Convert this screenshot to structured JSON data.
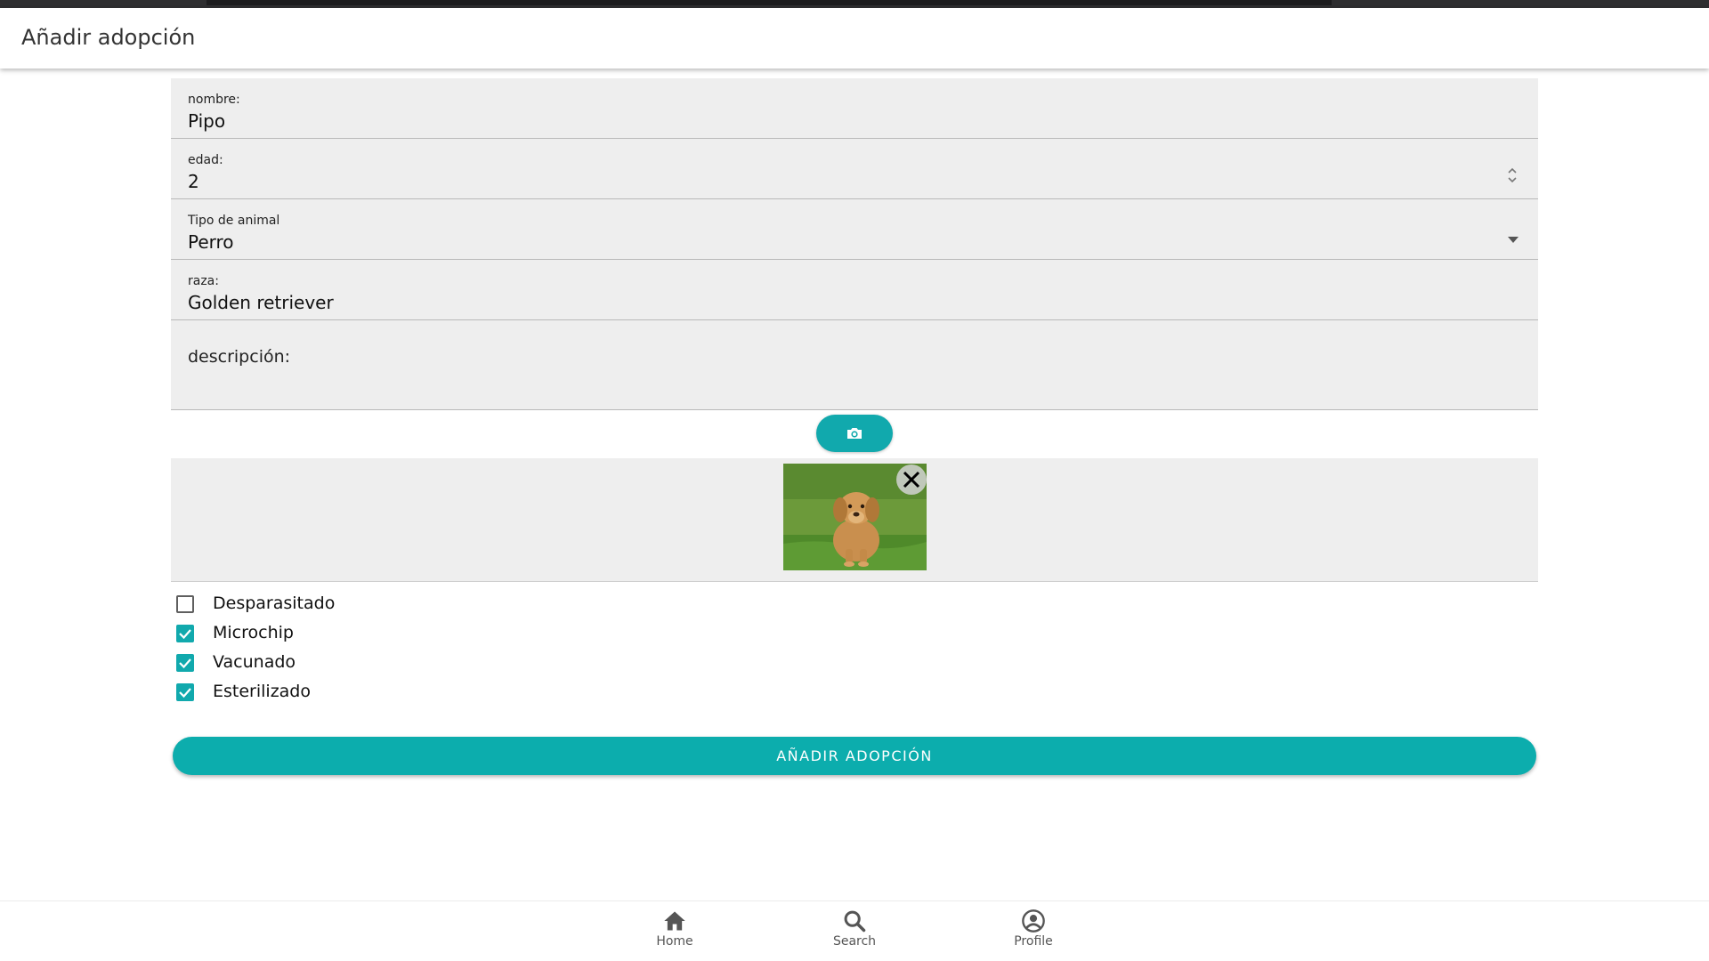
{
  "header": {
    "title": "Añadir adopción"
  },
  "form": {
    "nombre": {
      "label": "nombre:",
      "value": "Pipo"
    },
    "edad": {
      "label": "edad:",
      "value": "2"
    },
    "tipo": {
      "label": "Tipo de animal",
      "value": "Perro"
    },
    "raza": {
      "label": "raza:",
      "value": "Golden retriever"
    },
    "descripcion": {
      "label": "descripción:",
      "value": ""
    }
  },
  "camera_button": {
    "icon": "camera-icon"
  },
  "image": {
    "content": "golden retriever puppy sitting on grass",
    "remove_icon": "close-icon"
  },
  "checkboxes": [
    {
      "label": "Desparasitado",
      "checked": false
    },
    {
      "label": "Microchip",
      "checked": true
    },
    {
      "label": "Vacunado",
      "checked": true
    },
    {
      "label": "Esterilizado",
      "checked": true
    }
  ],
  "submit": {
    "label": "AÑADIR ADOPCIÓN"
  },
  "nav": [
    {
      "label": "Home",
      "icon": "home-icon"
    },
    {
      "label": "Search",
      "icon": "search-icon"
    },
    {
      "label": "Profile",
      "icon": "profile-icon"
    }
  ],
  "colors": {
    "accent": "#11a9ad",
    "field_bg": "#eeeeee"
  }
}
